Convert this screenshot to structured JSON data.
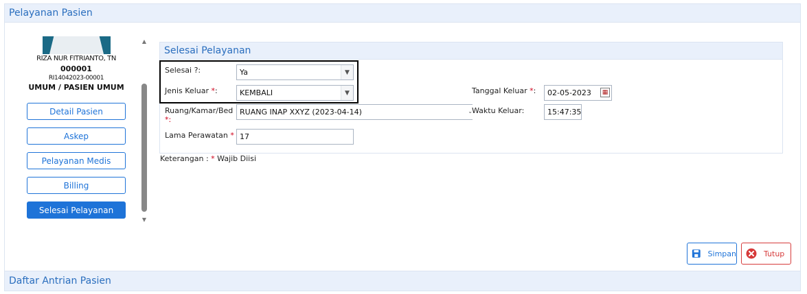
{
  "panels": {
    "top_title": "Pelayanan Pasien",
    "bottom_title": "Daftar Antrian Pasien"
  },
  "patient": {
    "name": "RIZA NUR FITRIANTO, TN",
    "rm_number": "000001",
    "reg_number": "RI14042023-00001",
    "payer": "UMUM / PASIEN UMUM"
  },
  "nav": {
    "items": [
      {
        "label": "Detail Pasien"
      },
      {
        "label": "Askep"
      },
      {
        "label": "Pelayanan Medis"
      },
      {
        "label": "Billing"
      },
      {
        "label": "Selesai Pelayanan"
      }
    ]
  },
  "section": {
    "title": "Selesai Pelayanan"
  },
  "form": {
    "selesai_label": "Selesai ?:",
    "selesai_value": "Ya",
    "jenis_label": "Jenis Keluar ",
    "jenis_value": "KEMBALI",
    "ruang_label": "Ruang/Kamar/Bed",
    "ruang_value": "RUANG INAP XXYZ (2023-04-14)",
    "lama_label": "Lama Perawatan ",
    "lama_value": "17",
    "tanggal_label": "Tanggal Keluar ",
    "tanggal_value": "02-05-2023",
    "waktu_label": "Waktu Keluar:",
    "waktu_value": "15:47:35",
    "required_mark": "*",
    "colon": ":",
    "required_colon": "*:",
    "keterangan_prefix": "Keterangan : ",
    "keterangan_suffix": " Wajib Diisi"
  },
  "actions": {
    "save_label": "Simpan",
    "close_label": "Tutup"
  },
  "colors": {
    "accent": "#1e73d8",
    "danger": "#d63a3a",
    "header_bg": "#e9f0fb"
  }
}
